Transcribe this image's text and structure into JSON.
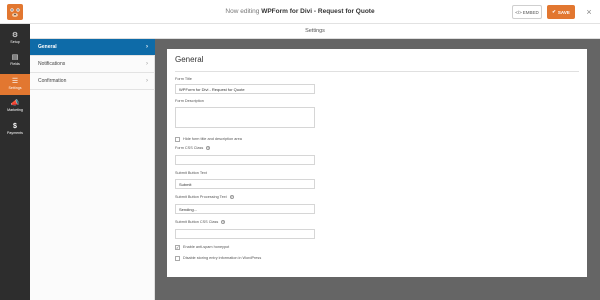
{
  "header": {
    "editing_prefix": "Now editing",
    "form_name": "WPForm for Divi - Request for Quote",
    "embed_label": "EMBED",
    "save_label": "SAVE"
  },
  "sidebar": {
    "items": [
      {
        "label": "Setup",
        "icon": "gear-icon"
      },
      {
        "label": "Fields",
        "icon": "fields-icon"
      },
      {
        "label": "Settings",
        "icon": "sliders-icon"
      },
      {
        "label": "Marketing",
        "icon": "megaphone-icon"
      },
      {
        "label": "Payments",
        "icon": "dollar-icon"
      }
    ],
    "active": "Settings"
  },
  "section_title": "Settings",
  "panel": {
    "tabs": [
      {
        "label": "General",
        "active": true
      },
      {
        "label": "Notifications",
        "active": false
      },
      {
        "label": "Confirmation",
        "active": false
      }
    ]
  },
  "general": {
    "title": "General",
    "form_title_label": "Form Title",
    "form_title_value": "WPForm for Divi - Request for Quote",
    "form_description_label": "Form Description",
    "hide_title_label": "Hide form title and description area",
    "css_class_label": "Form CSS Class",
    "submit_text_label": "Submit Button Text",
    "submit_text_value": "Submit",
    "submit_processing_label": "Submit Button Processing Text",
    "submit_processing_value": "Sending...",
    "submit_css_label": "Submit Button CSS Class",
    "honeypot_label": "Enable anti-spam honeypot",
    "honeypot_checked": true,
    "disable_storing_label": "Disable storing entry information in WordPress",
    "disable_storing_checked": false
  },
  "colors": {
    "accent": "#e27730",
    "tab_active": "#0e6ba8",
    "sidebar_bg": "#2d2d2d",
    "content_bg": "#656565"
  }
}
